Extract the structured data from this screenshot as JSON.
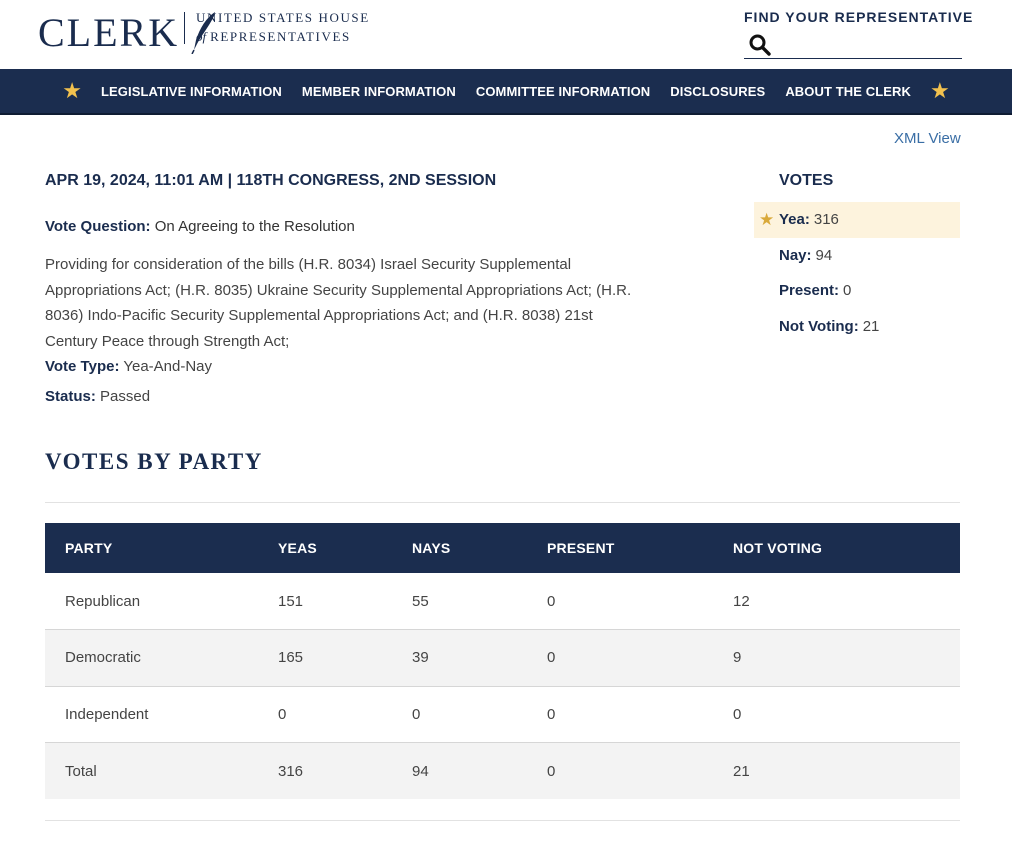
{
  "header": {
    "logo_word": "CLERK",
    "logo_line1": "UNITED STATES HOUSE",
    "logo_line2_of": "of",
    "logo_line2": "REPRESENTATIVES",
    "find_label": "FIND YOUR REPRESENTATIVE",
    "search_placeholder": ""
  },
  "nav": {
    "items": [
      {
        "label": "LEGISLATIVE INFORMATION"
      },
      {
        "label": "MEMBER INFORMATION"
      },
      {
        "label": "COMMITTEE INFORMATION"
      },
      {
        "label": "DISCLOSURES"
      },
      {
        "label": "ABOUT THE CLERK"
      }
    ]
  },
  "xml_view": "XML View",
  "vote": {
    "title": "APR 19, 2024, 11:01 AM | 118TH CONGRESS, 2ND SESSION",
    "question_label": "Vote Question:",
    "question": "On Agreeing to the Resolution",
    "description": "Providing for consideration of the bills (H.R. 8034) Israel Security Supplemental Appropriations Act; (H.R. 8035) Ukraine Security Supplemental Appropriations Act; (H.R. 8036) Indo-Pacific Security Supplemental Appropriations Act; and (H.R. 8038) 21st Century Peace through Strength Act;",
    "type_label": "Vote Type:",
    "type": "Yea-And-Nay",
    "status_label": "Status:",
    "status": "Passed"
  },
  "votes": {
    "heading": "VOTES",
    "rows": [
      {
        "label": "Yea:",
        "value": "316"
      },
      {
        "label": "Nay:",
        "value": "94"
      },
      {
        "label": "Present:",
        "value": "0"
      },
      {
        "label": "Not Voting:",
        "value": "21"
      }
    ]
  },
  "party": {
    "heading": "VOTES BY PARTY",
    "columns": [
      "PARTY",
      "YEAS",
      "NAYS",
      "PRESENT",
      "NOT VOTING"
    ],
    "rows": [
      [
        "Republican",
        "151",
        "55",
        "0",
        "12"
      ],
      [
        "Democratic",
        "165",
        "39",
        "0",
        "9"
      ],
      [
        "Independent",
        "0",
        "0",
        "0",
        "0"
      ],
      [
        "Total",
        "316",
        "94",
        "0",
        "21"
      ]
    ]
  },
  "colors": {
    "navy": "#1b2d4f",
    "gold_star": "#f2c14e",
    "link": "#3a6ea5",
    "winner_highlight": "#fdf3dd"
  },
  "icons": {
    "search": "search-icon",
    "quill": "quill-icon",
    "star": "star-icon"
  }
}
